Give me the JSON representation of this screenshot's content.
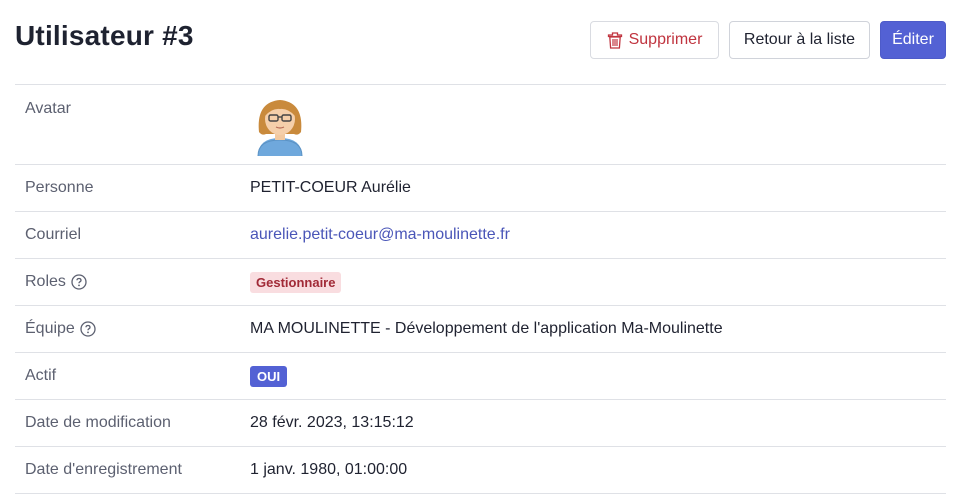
{
  "header": {
    "title": "Utilisateur #3",
    "delete_label": "Supprimer",
    "back_label": "Retour à la liste",
    "edit_label": "Éditer"
  },
  "fields": {
    "avatar": {
      "label": "Avatar",
      "icon": "woman-avatar-icon"
    },
    "person": {
      "label": "Personne",
      "value": "PETIT-COEUR Aurélie"
    },
    "email": {
      "label": "Courriel",
      "value": "aurelie.petit-coeur@ma-moulinette.fr"
    },
    "roles": {
      "label": "Roles",
      "value": "Gestionnaire"
    },
    "team": {
      "label": "Équipe",
      "value": "MA MOULINETTE - Développement de l'application Ma-Moulinette"
    },
    "active": {
      "label": "Actif",
      "value": "OUI"
    },
    "modified": {
      "label": "Date de modification",
      "value": "28 févr. 2023, 13:15:12"
    },
    "registered": {
      "label": "Date d'enregistrement",
      "value": "1 janv. 1980, 01:00:00"
    }
  },
  "colors": {
    "primary": "#5361d4",
    "danger": "#c0343f",
    "link": "#4a56b8",
    "role_badge_bg": "#f9dde0"
  }
}
